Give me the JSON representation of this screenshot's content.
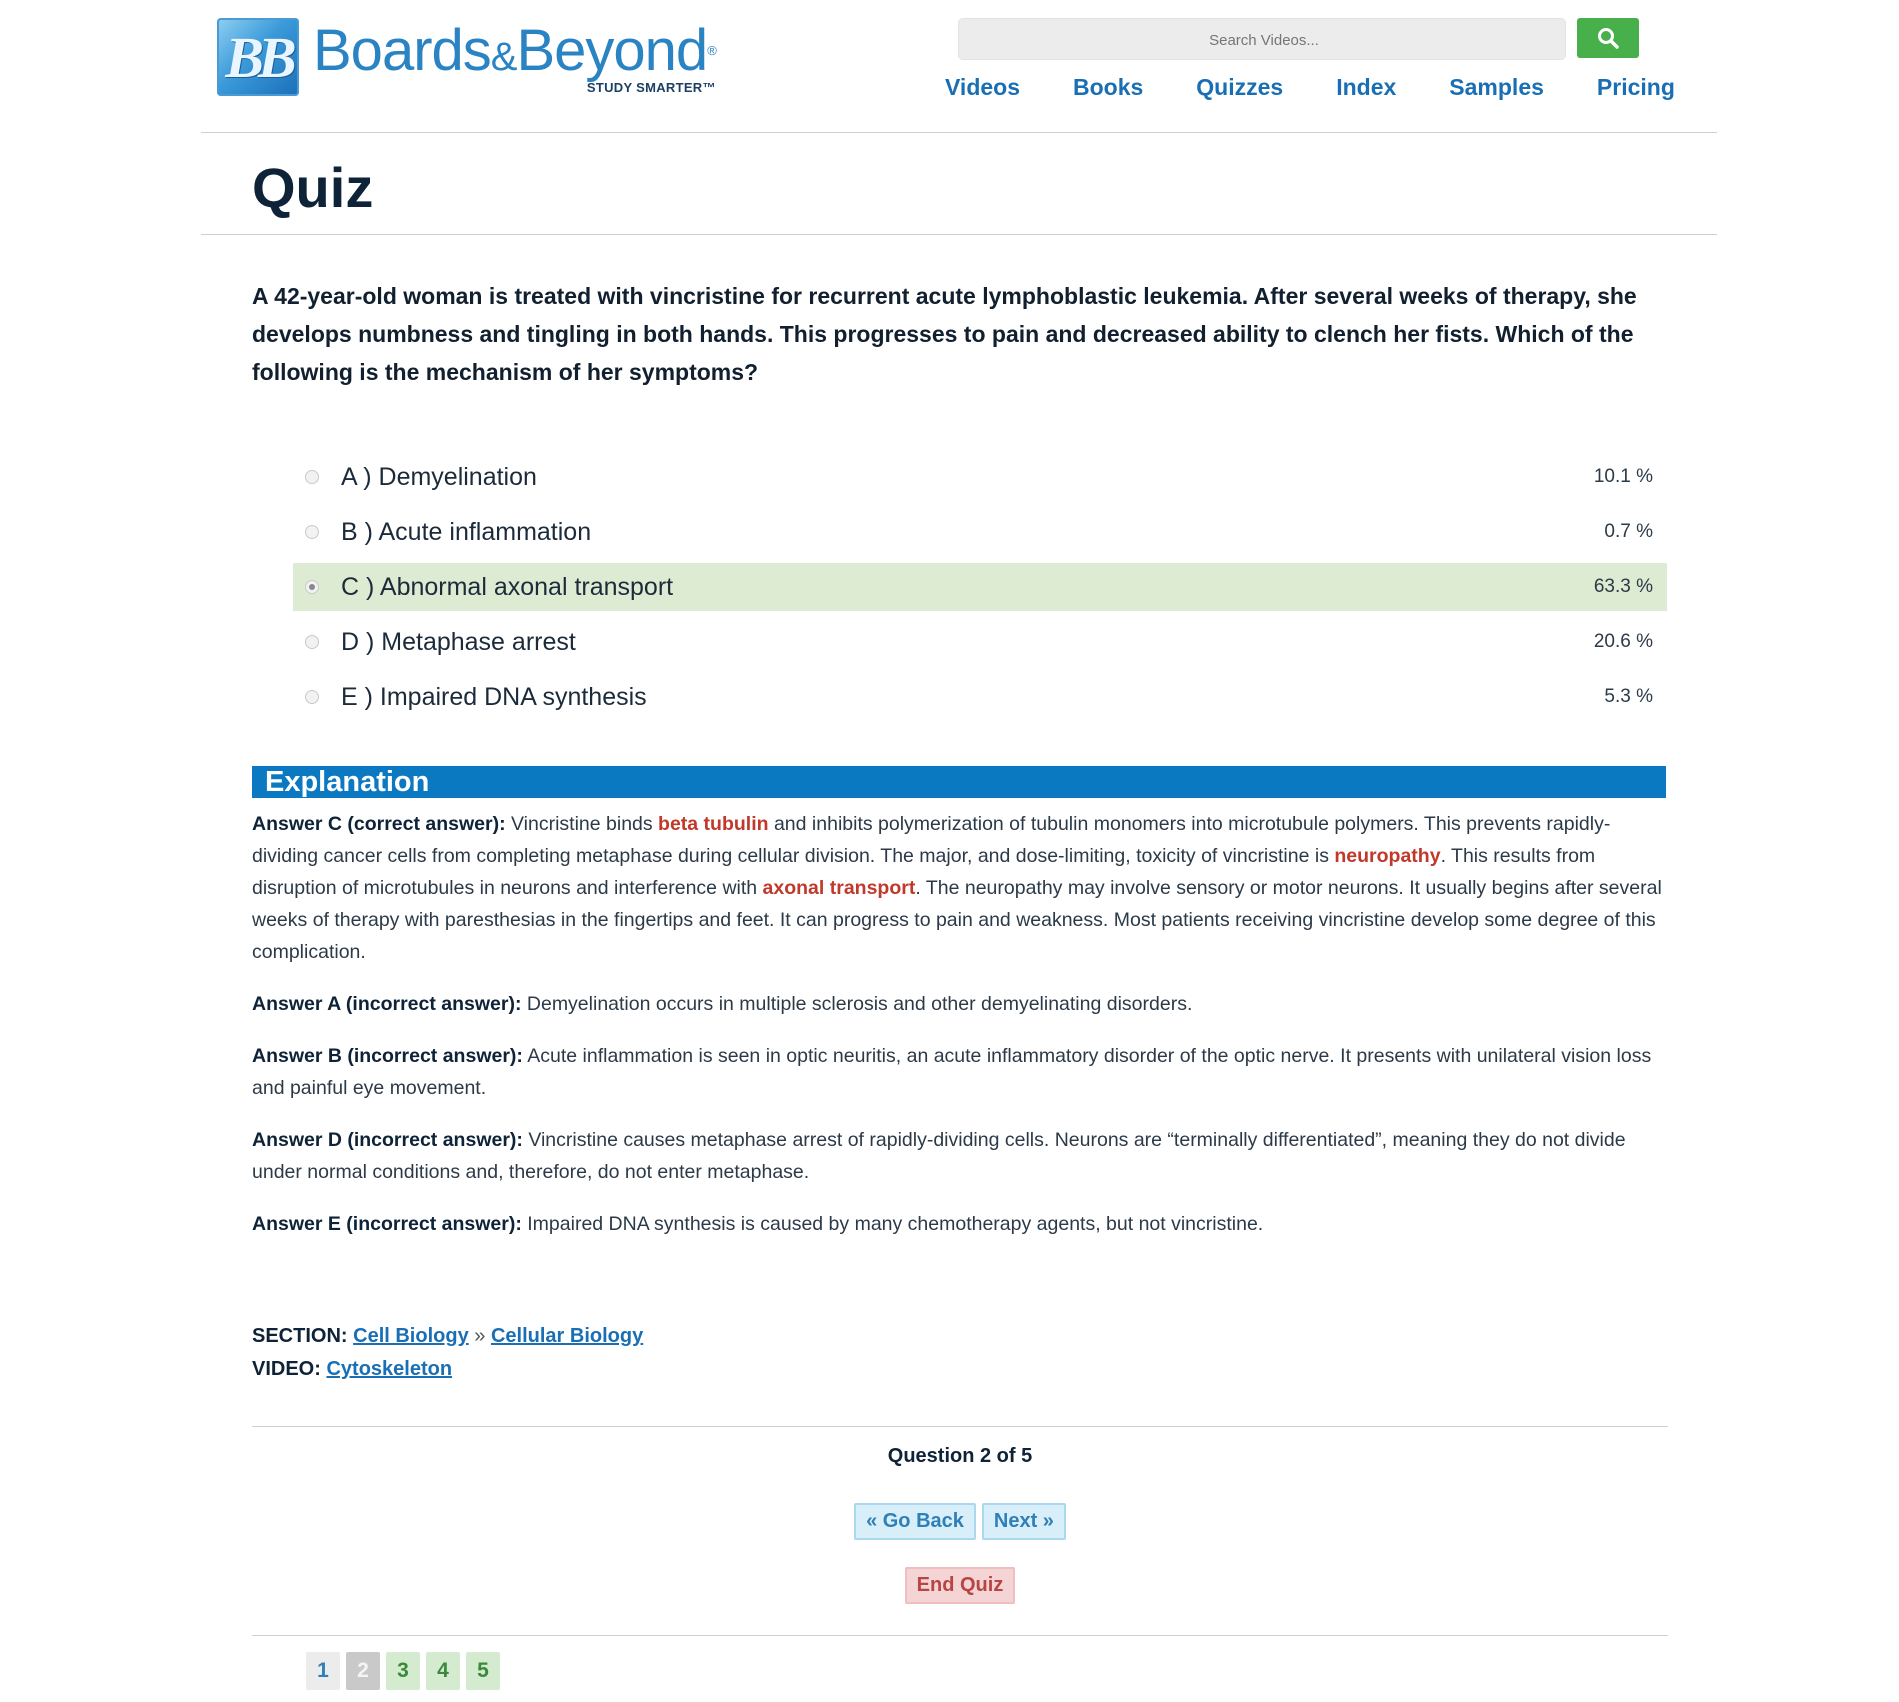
{
  "header": {
    "logo_mark": "BB",
    "brand_part1": "Boards",
    "brand_amp": "&",
    "brand_part2": "Beyond",
    "brand_reg": "®",
    "tagline": "STUDY SMARTER™",
    "search_placeholder": "Search Videos...",
    "nav": [
      "Videos",
      "Books",
      "Quizzes",
      "Index",
      "Samples",
      "Pricing"
    ]
  },
  "page_title": "Quiz",
  "question": "A 42-year-old woman is treated with vincristine for recurrent acute lymphoblastic leukemia. After several weeks of therapy, she develops numbness and tingling in both hands. This progresses to pain and decreased ability to clench her fists. Which of the following is the mechanism of her symptoms?",
  "choices": [
    {
      "label": "A ) Demyelination",
      "percent": "10.1 %"
    },
    {
      "label": "B ) Acute inflammation",
      "percent": "0.7 %"
    },
    {
      "label": "C ) Abnormal axonal transport",
      "percent": "63.3 %"
    },
    {
      "label": "D ) Metaphase arrest",
      "percent": "20.6 %"
    },
    {
      "label": "E ) Impaired DNA synthesis",
      "percent": "5.3 %"
    }
  ],
  "explanation": {
    "heading": "Explanation",
    "c": {
      "lead": "Answer C (correct answer):",
      "t1": " Vincristine binds ",
      "h1": "beta tubulin",
      "t2": " and inhibits polymerization of tubulin monomers into microtubule polymers. This prevents rapidly-dividing cancer cells from completing metaphase during cellular division. The major, and dose-limiting, toxicity of vincristine is ",
      "h2": "neuropathy",
      "t3": ". This results from disruption of microtubules in neurons and interference with ",
      "h3": "axonal transport",
      "t4": ". The neuropathy may involve sensory or motor neurons. It usually begins after several weeks of therapy with paresthesias in the fingertips and feet. It can progress to pain and weakness. Most patients receiving vincristine develop some degree of this complication."
    },
    "a": {
      "lead": "Answer A (incorrect answer):",
      "text": " Demyelination occurs in multiple sclerosis and other demyelinating disorders."
    },
    "b": {
      "lead": "Answer B (incorrect answer):",
      "text": " Acute inflammation is seen in optic neuritis, an acute inflammatory disorder of the optic nerve. It presents with unilateral vision loss and painful eye movement."
    },
    "d": {
      "lead": "Answer D (incorrect answer):",
      "text": " Vincristine causes metaphase arrest of rapidly-dividing cells. Neurons are “terminally differentiated”, meaning they do not divide under normal conditions and, therefore, do not enter metaphase."
    },
    "e": {
      "lead": "Answer E (incorrect answer):",
      "text": " Impaired DNA synthesis is caused by many chemotherapy agents, but not vincristine."
    }
  },
  "meta": {
    "section_label": "SECTION:",
    "section_link1": "Cell Biology",
    "separator": "»",
    "section_link2": "Cellular Biology",
    "video_label": "VIDEO:",
    "video_link": "Cytoskeleton"
  },
  "pager": {
    "question_count": "Question 2 of 5",
    "back": "« Go Back",
    "next": "Next »",
    "end": "End Quiz",
    "pages": [
      "1",
      "2",
      "3",
      "4",
      "5"
    ]
  },
  "colors": {
    "brand_blue": "#1a6fb4",
    "search_green": "#47b04b",
    "correct_bg": "#dcebd2",
    "explanation_bar": "#0b78c2",
    "highlight_red": "#c0392b"
  }
}
